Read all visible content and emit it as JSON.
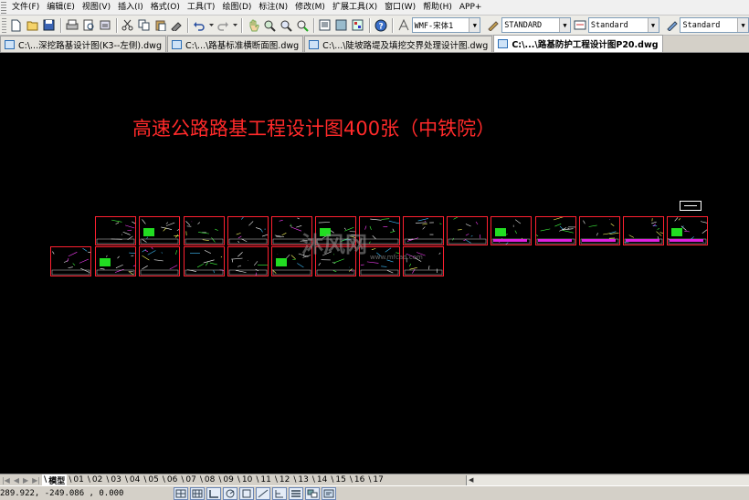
{
  "menu": [
    "文件(F)",
    "编辑(E)",
    "视图(V)",
    "插入(I)",
    "格式(O)",
    "工具(T)",
    "绘图(D)",
    "标注(N)",
    "修改(M)",
    "扩展工具(X)",
    "窗口(W)",
    "帮助(H)",
    "APP+"
  ],
  "toolbar": {
    "font_combo": "WMF-宋体1",
    "text_style_combo": "STANDARD",
    "dim_style_combo": "Standard",
    "table_style_combo": "Standard"
  },
  "tabs": [
    {
      "label": "C:\\...深挖路基设计图(K3--左侧).dwg",
      "active": false
    },
    {
      "label": "C:\\...\\路基标准横断面图.dwg",
      "active": false
    },
    {
      "label": "C:\\...\\陡坡路堤及填挖交界处理设计图.dwg",
      "active": false
    },
    {
      "label": "C:\\...\\路基防护工程设计图P20.dwg",
      "active": true
    }
  ],
  "canvas": {
    "title": "高速公路路基工程设计图400张（中铁院）",
    "watermark": "沐风网",
    "watermark_url": "www.mfcad.com"
  },
  "layout_tabs": [
    "模型",
    "01",
    "02",
    "03",
    "04",
    "05",
    "06",
    "07",
    "08",
    "09",
    "10",
    "11",
    "12",
    "13",
    "14",
    "15",
    "16",
    "17"
  ],
  "status": {
    "coordinates": "289.922,  -249.086 , 0.000"
  },
  "colors": {
    "canvas_bg": "#000000",
    "title": "#ff2a2a",
    "sheet_border": "#ff2030"
  }
}
